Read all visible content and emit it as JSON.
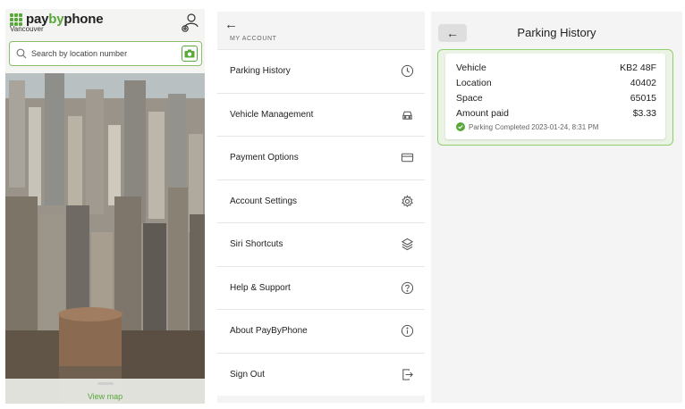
{
  "home": {
    "brand": {
      "pay": "pay",
      "by": "by",
      "phone": "phone"
    },
    "city": "Vancouver",
    "search_placeholder": "Search by location number",
    "view_map": "View map"
  },
  "account": {
    "section_label": "MY ACCOUNT",
    "items": [
      {
        "label": "Parking History",
        "icon": "clock-icon"
      },
      {
        "label": "Vehicle Management",
        "icon": "car-icon"
      },
      {
        "label": "Payment Options",
        "icon": "credit-card-icon"
      },
      {
        "label": "Account Settings",
        "icon": "gear-icon"
      },
      {
        "label": "Siri Shortcuts",
        "icon": "siri-shortcuts-icon"
      },
      {
        "label": "Help & Support",
        "icon": "question-icon"
      },
      {
        "label": "About PayByPhone",
        "icon": "info-icon"
      },
      {
        "label": "Sign Out",
        "icon": "sign-out-icon"
      }
    ]
  },
  "history": {
    "title": "Parking History",
    "record": {
      "vehicle_label": "Vehicle",
      "vehicle": "KB2 48F",
      "location_label": "Location",
      "location": "40402",
      "space_label": "Space",
      "space": "65015",
      "amount_label": "Amount paid",
      "amount": "$3.33",
      "status": "Parking Completed 2023-01-24, 8:31 PM"
    }
  },
  "colors": {
    "accent": "#58a83a",
    "card_border": "#8fcf70"
  }
}
